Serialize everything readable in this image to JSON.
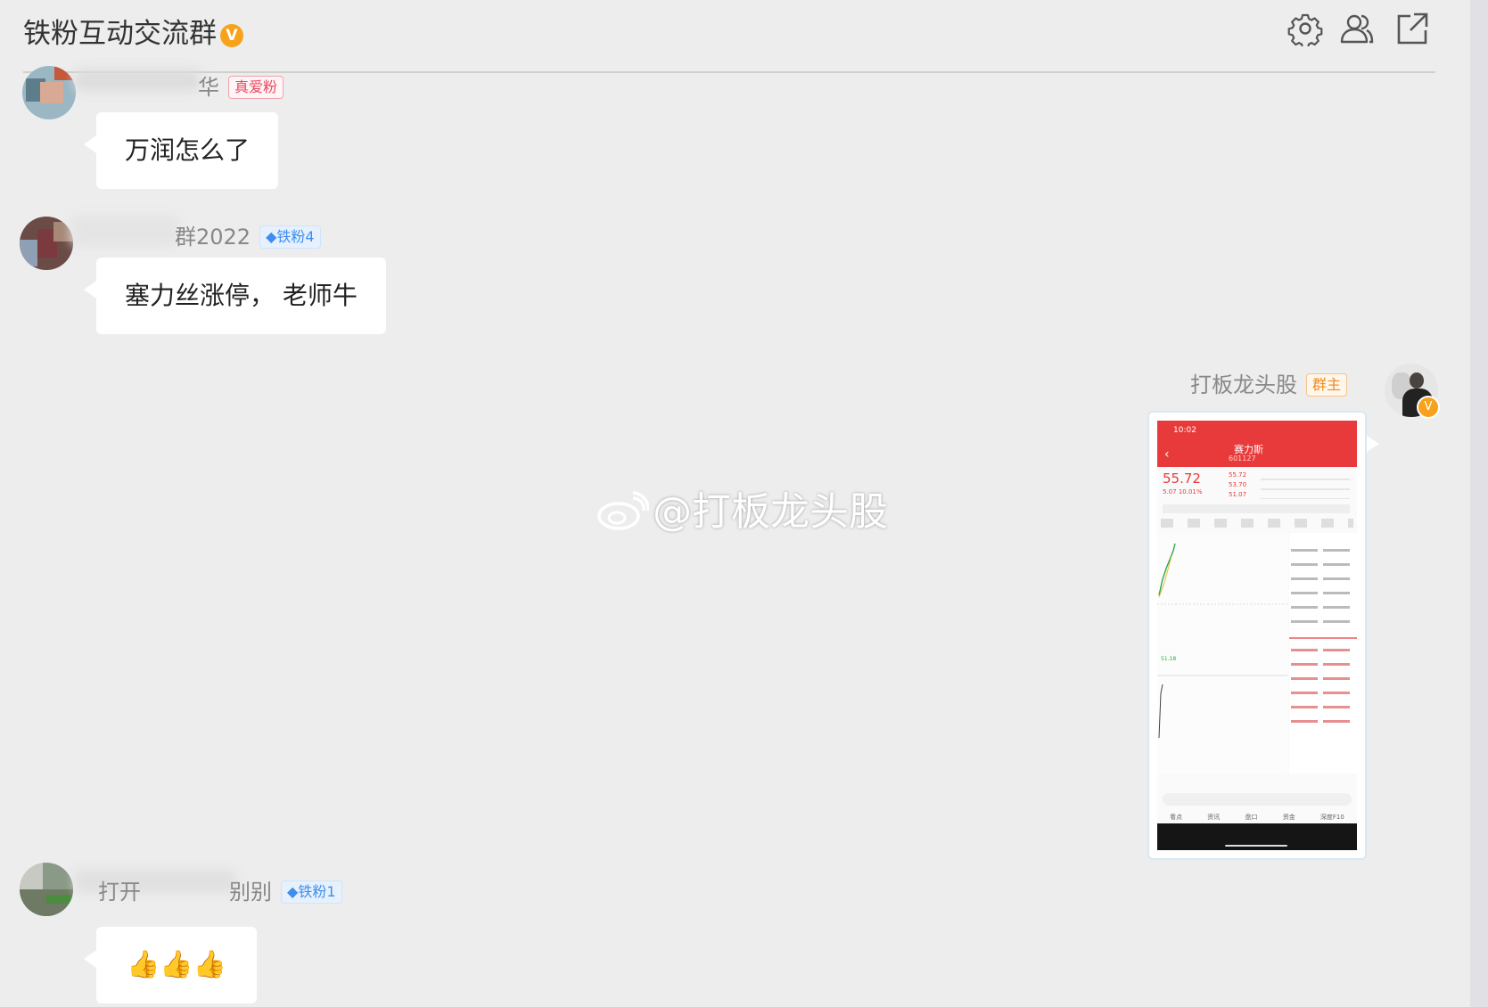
{
  "window": {
    "title": "铁粉互动交流群",
    "title_badge": "V"
  },
  "header_icons": [
    "gear-icon",
    "group-members-icon",
    "external-link-icon"
  ],
  "messages": [
    {
      "sender_name": "华",
      "tag": "真爱粉",
      "text": "万润怎么了"
    },
    {
      "sender_name": "群2022",
      "tag": "铁粉4",
      "text": "塞力丝涨停， 老师牛"
    },
    {
      "sender_name": "打板龙头股",
      "tag": "群主",
      "verified_badge": "V",
      "content": "image"
    },
    {
      "sender_name_parts": [
        "打开",
        "别别"
      ],
      "tag": "铁粉1",
      "text": "👍👍👍"
    }
  ],
  "screenshot": {
    "time": "10:02",
    "stock_name": "赛力斯",
    "code": "601127",
    "price": "55.72",
    "change": "5.07",
    "change_pct": "10.01%",
    "stats": [
      "55.72",
      "53.70",
      "51.07"
    ],
    "lower_price": "51.18",
    "tabs": [
      "看点",
      "资讯",
      "盘口",
      "资金",
      "深度F10"
    ]
  },
  "watermark": {
    "text": "@打板龙头股"
  }
}
